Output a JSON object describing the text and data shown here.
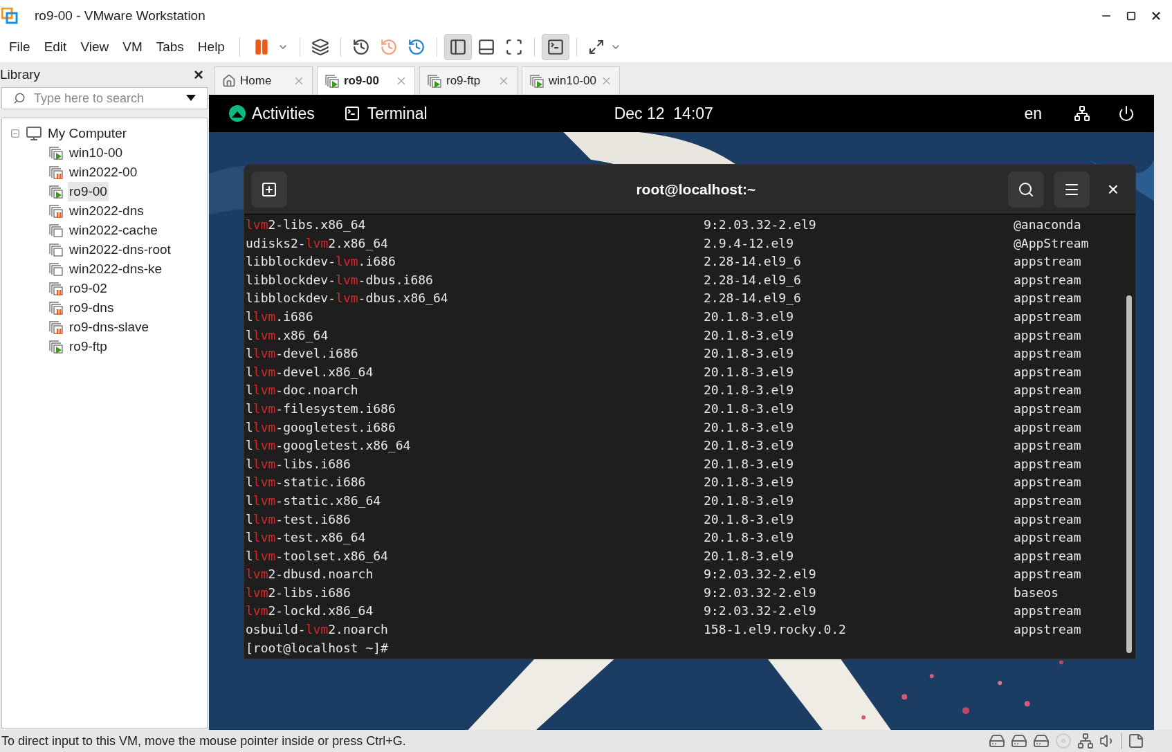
{
  "window": {
    "title": "ro9-00 - VMware Workstation"
  },
  "menu": [
    "File",
    "Edit",
    "View",
    "VM",
    "Tabs",
    "Help"
  ],
  "library": {
    "title": "Library",
    "close": "×",
    "search": {
      "placeholder": "Type here to search"
    },
    "tree": {
      "label": "My Computer",
      "expanded": true,
      "children": [
        {
          "label": "win10-00",
          "kind": "running",
          "selected": false
        },
        {
          "label": "win2022-00",
          "kind": "suspended",
          "selected": false
        },
        {
          "label": "ro9-00",
          "kind": "running",
          "selected": true
        },
        {
          "label": "win2022-dns",
          "kind": "suspended",
          "selected": false
        },
        {
          "label": "win2022-cache",
          "kind": "off",
          "selected": false
        },
        {
          "label": "win2022-dns-root",
          "kind": "off",
          "selected": false
        },
        {
          "label": "win2022-dns-ke",
          "kind": "off",
          "selected": false
        },
        {
          "label": "ro9-02",
          "kind": "suspended",
          "selected": false
        },
        {
          "label": "ro9-dns",
          "kind": "suspended",
          "selected": false
        },
        {
          "label": "ro9-dns-slave",
          "kind": "suspended",
          "selected": false
        },
        {
          "label": "ro9-ftp",
          "kind": "running",
          "selected": false
        }
      ]
    }
  },
  "tabs": [
    {
      "label": "Home",
      "kind": "home",
      "selected": false
    },
    {
      "label": "ro9-00",
      "kind": "vm",
      "selected": true
    },
    {
      "label": "ro9-ftp",
      "kind": "vm",
      "selected": false
    },
    {
      "label": "win10-00",
      "kind": "vm",
      "selected": false
    }
  ],
  "guest": {
    "top_bar": {
      "activities": "Activities",
      "app": "Terminal",
      "clock": "Dec 12  14:07",
      "language": "en"
    },
    "terminal": {
      "title": "root@localhost:~",
      "close": "×",
      "rows": [
        {
          "name": [
            {
              "text": "lvm",
              "match": true
            },
            {
              "text": "2-libs.x86_64",
              "match": false
            }
          ],
          "version": "9:2.03.32-2.el9",
          "repo": "@anaconda"
        },
        {
          "name": [
            {
              "text": "udisks2-",
              "match": false
            },
            {
              "text": "lvm",
              "match": true
            },
            {
              "text": "2.x86_64",
              "match": false
            }
          ],
          "version": "2.9.4-12.el9",
          "repo": "@AppStream"
        },
        {
          "name": [
            {
              "text": "libblockdev-",
              "match": false
            },
            {
              "text": "lvm",
              "match": true
            },
            {
              "text": ".i686",
              "match": false
            }
          ],
          "version": "2.28-14.el9_6",
          "repo": "appstream"
        },
        {
          "name": [
            {
              "text": "libblockdev-",
              "match": false
            },
            {
              "text": "lvm",
              "match": true
            },
            {
              "text": "-dbus.i686",
              "match": false
            }
          ],
          "version": "2.28-14.el9_6",
          "repo": "appstream"
        },
        {
          "name": [
            {
              "text": "libblockdev-",
              "match": false
            },
            {
              "text": "lvm",
              "match": true
            },
            {
              "text": "-dbus.x86_64",
              "match": false
            }
          ],
          "version": "2.28-14.el9_6",
          "repo": "appstream"
        },
        {
          "name": [
            {
              "text": "l",
              "match": false
            },
            {
              "text": "lvm",
              "match": true
            },
            {
              "text": ".i686",
              "match": false
            }
          ],
          "version": "20.1.8-3.el9",
          "repo": "appstream"
        },
        {
          "name": [
            {
              "text": "l",
              "match": false
            },
            {
              "text": "lvm",
              "match": true
            },
            {
              "text": ".x86_64",
              "match": false
            }
          ],
          "version": "20.1.8-3.el9",
          "repo": "appstream"
        },
        {
          "name": [
            {
              "text": "l",
              "match": false
            },
            {
              "text": "lvm",
              "match": true
            },
            {
              "text": "-devel.i686",
              "match": false
            }
          ],
          "version": "20.1.8-3.el9",
          "repo": "appstream"
        },
        {
          "name": [
            {
              "text": "l",
              "match": false
            },
            {
              "text": "lvm",
              "match": true
            },
            {
              "text": "-devel.x86_64",
              "match": false
            }
          ],
          "version": "20.1.8-3.el9",
          "repo": "appstream"
        },
        {
          "name": [
            {
              "text": "l",
              "match": false
            },
            {
              "text": "lvm",
              "match": true
            },
            {
              "text": "-doc.noarch",
              "match": false
            }
          ],
          "version": "20.1.8-3.el9",
          "repo": "appstream"
        },
        {
          "name": [
            {
              "text": "l",
              "match": false
            },
            {
              "text": "lvm",
              "match": true
            },
            {
              "text": "-filesystem.i686",
              "match": false
            }
          ],
          "version": "20.1.8-3.el9",
          "repo": "appstream"
        },
        {
          "name": [
            {
              "text": "l",
              "match": false
            },
            {
              "text": "lvm",
              "match": true
            },
            {
              "text": "-googletest.i686",
              "match": false
            }
          ],
          "version": "20.1.8-3.el9",
          "repo": "appstream"
        },
        {
          "name": [
            {
              "text": "l",
              "match": false
            },
            {
              "text": "lvm",
              "match": true
            },
            {
              "text": "-googletest.x86_64",
              "match": false
            }
          ],
          "version": "20.1.8-3.el9",
          "repo": "appstream"
        },
        {
          "name": [
            {
              "text": "l",
              "match": false
            },
            {
              "text": "lvm",
              "match": true
            },
            {
              "text": "-libs.i686",
              "match": false
            }
          ],
          "version": "20.1.8-3.el9",
          "repo": "appstream"
        },
        {
          "name": [
            {
              "text": "l",
              "match": false
            },
            {
              "text": "lvm",
              "match": true
            },
            {
              "text": "-static.i686",
              "match": false
            }
          ],
          "version": "20.1.8-3.el9",
          "repo": "appstream"
        },
        {
          "name": [
            {
              "text": "l",
              "match": false
            },
            {
              "text": "lvm",
              "match": true
            },
            {
              "text": "-static.x86_64",
              "match": false
            }
          ],
          "version": "20.1.8-3.el9",
          "repo": "appstream"
        },
        {
          "name": [
            {
              "text": "l",
              "match": false
            },
            {
              "text": "lvm",
              "match": true
            },
            {
              "text": "-test.i686",
              "match": false
            }
          ],
          "version": "20.1.8-3.el9",
          "repo": "appstream"
        },
        {
          "name": [
            {
              "text": "l",
              "match": false
            },
            {
              "text": "lvm",
              "match": true
            },
            {
              "text": "-test.x86_64",
              "match": false
            }
          ],
          "version": "20.1.8-3.el9",
          "repo": "appstream"
        },
        {
          "name": [
            {
              "text": "l",
              "match": false
            },
            {
              "text": "lvm",
              "match": true
            },
            {
              "text": "-toolset.x86_64",
              "match": false
            }
          ],
          "version": "20.1.8-3.el9",
          "repo": "appstream"
        },
        {
          "name": [
            {
              "text": "lvm",
              "match": true
            },
            {
              "text": "2-dbusd.noarch",
              "match": false
            }
          ],
          "version": "9:2.03.32-2.el9",
          "repo": "appstream"
        },
        {
          "name": [
            {
              "text": "lvm",
              "match": true
            },
            {
              "text": "2-libs.i686",
              "match": false
            }
          ],
          "version": "9:2.03.32-2.el9",
          "repo": "baseos"
        },
        {
          "name": [
            {
              "text": "lvm",
              "match": true
            },
            {
              "text": "2-lockd.x86_64",
              "match": false
            }
          ],
          "version": "9:2.03.32-2.el9",
          "repo": "appstream"
        },
        {
          "name": [
            {
              "text": "osbuild-",
              "match": false
            },
            {
              "text": "lvm",
              "match": true
            },
            {
              "text": "2.noarch",
              "match": false
            }
          ],
          "version": "158-1.el9.rocky.0.2",
          "repo": "appstream"
        }
      ],
      "prompt": "[root@localhost ~]#"
    }
  },
  "status_bar": {
    "message": "To direct input to this VM, move the mouse pointer inside or press Ctrl+G."
  }
}
